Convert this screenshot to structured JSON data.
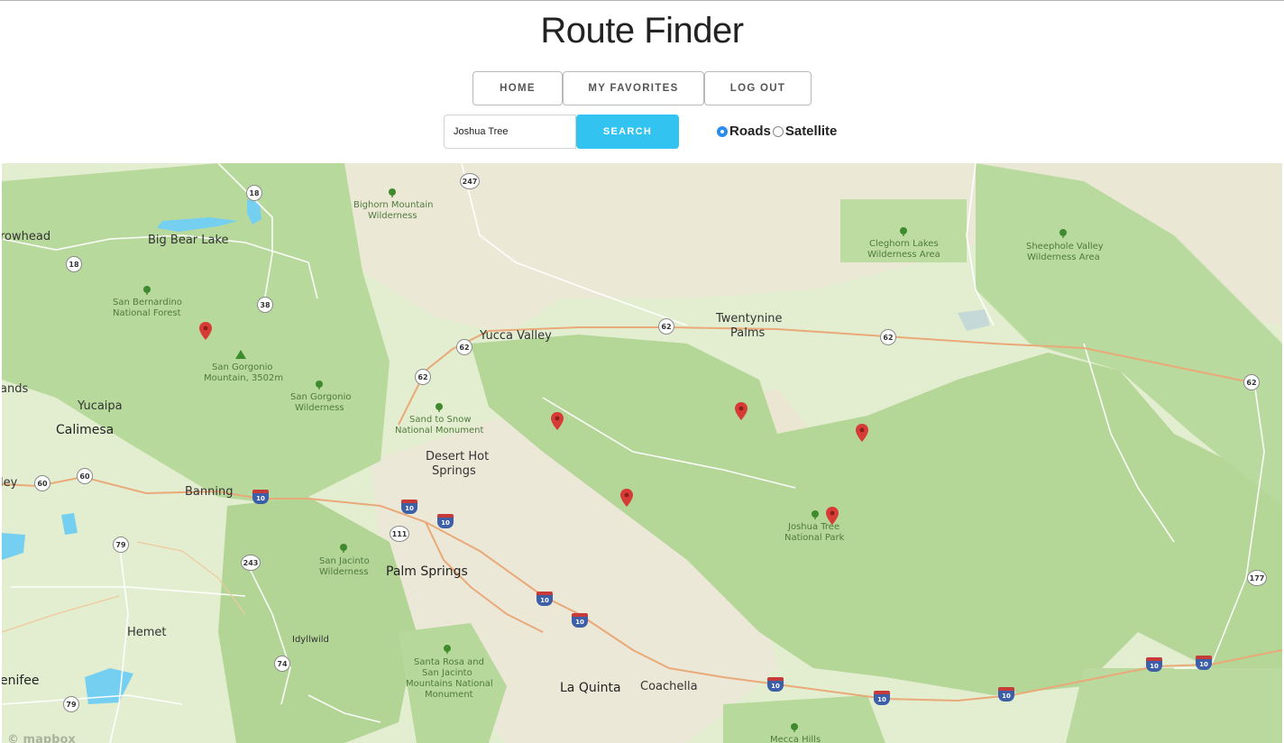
{
  "app": {
    "title": "Route Finder"
  },
  "nav": {
    "home_label": "HOME",
    "favorites_label": "MY FAVORITES",
    "logout_label": "LOG OUT"
  },
  "search": {
    "value": "Joshua Tree",
    "button_label": "SEARCH"
  },
  "layers": {
    "roads_label": "Roads",
    "satellite_label": "Satellite",
    "selected": "Roads"
  },
  "map": {
    "attribution": "© mapbox",
    "colors": {
      "land": "#dfecc6",
      "forest": "#b9dba0",
      "desert": "#eee8d3",
      "water": "#75cff0",
      "road_major": "#e9a978",
      "road_minor": "#ffffff",
      "pin": "#d63b36",
      "accent": "#33c3f0"
    },
    "cities": {
      "arrowhead": "rowhead",
      "bigbear": "Big Bear Lake",
      "yucca": "Yucca Valley",
      "twentynine": "Twentynine",
      "twentynine2": "Palms",
      "redlands": "ands",
      "yucaipa": "Yucaipa",
      "calimesa": "Calimesa",
      "valley": "ley",
      "banning": "Banning",
      "deserthot": "Desert Hot",
      "deserthot2": "Springs",
      "palmsprings": "Palm Springs",
      "hemet": "Hemet",
      "idyllwild": "Idyllwild",
      "laquinta": "La Quinta",
      "coachella": "Coachella",
      "menifee": "enifee"
    },
    "parks": {
      "bighorn": "Bighorn Mountain",
      "bighorn2": "Wilderness",
      "cleghorn": "Cleghorn Lakes",
      "cleghorn2": "Wilderness Area",
      "sheephole": "Sheephole Valley",
      "sheephole2": "Wilderness Area",
      "sanbern": "San Bernardino",
      "sanbern2": "National Forest",
      "gorgonio_mt": "San Gorgonio",
      "gorgonio_mt2": "Mountain, 3502m",
      "gorgonio_w": "San Gorgonio",
      "gorgonio_w2": "Wilderness",
      "sandsnow": "Sand to Snow",
      "sandsnow2": "National Monument",
      "joshua": "Joshua Tree",
      "joshua2": "National Park",
      "jacinto": "San Jacinto",
      "jacinto2": "Wilderness",
      "santarosa": "Santa Rosa and",
      "santarosa2": "San Jacinto",
      "santarosa3": "Mountains National",
      "santarosa4": "Monument",
      "mecca": "Mecca Hills"
    },
    "routes": {
      "r18a": "18",
      "r18b": "18",
      "r247": "247",
      "r38": "38",
      "r62a": "62",
      "r62b": "62",
      "r62c": "62",
      "r62d": "62",
      "r62e": "62",
      "r60": "60",
      "r60b": "60",
      "r79a": "79",
      "r79b": "79",
      "r243": "243",
      "r111": "111",
      "r74": "74",
      "r177": "177",
      "i10a": "10",
      "i10b": "10",
      "i10c": "10",
      "i10d": "10",
      "i10e": "10",
      "i10f": "10",
      "i10g": "10",
      "i10h": "10",
      "i10i": "10",
      "i10j": "10"
    },
    "markers": [
      "trail-marker",
      "trail-marker",
      "trail-marker",
      "trail-marker",
      "trail-marker",
      "trail-marker"
    ]
  }
}
